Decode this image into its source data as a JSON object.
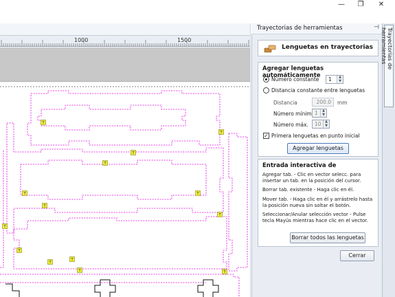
{
  "window": {
    "minimize_glyph": "—",
    "restore_glyph": "❐",
    "close_glyph": "✕"
  },
  "ruler": {
    "labels": [
      "1000",
      "1500"
    ]
  },
  "panel": {
    "title": "Trayectorias de herramientas",
    "side_tab": "Trayectorias de herramientas",
    "header_label": "Lenguetas en trayectorias",
    "auto": {
      "title": "Agregar lenguetas automáticamente",
      "constant_number_label": "Número constante",
      "constant_number_value": "1",
      "constant_distance_label": "Distancia constante entre lenguetas",
      "distance_label": "Distancia",
      "distance_value": "200.0",
      "distance_unit": "mm",
      "min_label": "Número mínimo",
      "min_value": "1",
      "max_label": "Número máx.",
      "max_value": "10",
      "first_tab_label": "Primera lenguetas en punto inicial",
      "add_button": "Agregar lenguetas"
    },
    "interactive": {
      "title": "Entrada interactiva de",
      "p1": "Agregar tab. - Clic en vector selecc. para insertar un tab. en la posición del cursor.",
      "p2": "Borrar tab. existente - Haga clic en él.",
      "p3": "Mover tab. - Haga clic en él y arrástrelo hasta la posición nueva sin soltar el botón.",
      "p4": "Seleccionar/Anular selección vector - Pulse tecla Mayús mientras hace clic en el vector.",
      "clear_button": "Borrar todos las lenguetas"
    },
    "close_button": "Cerrar"
  },
  "tab_marker": "T",
  "colors": {
    "toolpath": "#e000e0",
    "tab_fill": "#f2ef3a",
    "panel_bg": "#e9edf3"
  }
}
